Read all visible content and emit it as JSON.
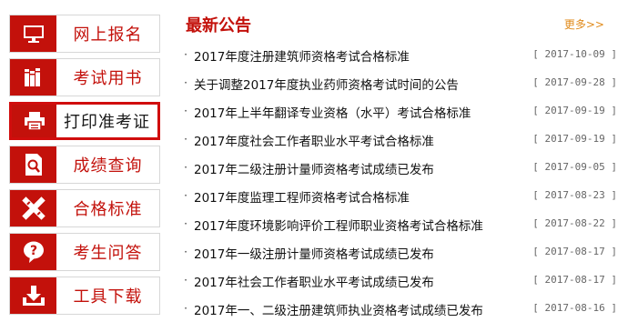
{
  "colors": {
    "brand_red": "#c3110b",
    "active_border": "#d00d0d",
    "more_orange": "#e08a1a"
  },
  "sidebar": {
    "items": [
      {
        "label": "网上报名",
        "icon": "monitor-icon",
        "active": false
      },
      {
        "label": "考试用书",
        "icon": "books-icon",
        "active": false
      },
      {
        "label": "打印准考证",
        "icon": "printer-icon",
        "active": true
      },
      {
        "label": "成绩查询",
        "icon": "document-search-icon",
        "active": false
      },
      {
        "label": "合格标准",
        "icon": "ruler-pencil-icon",
        "active": false
      },
      {
        "label": "考生问答",
        "icon": "question-bubble-icon",
        "active": false
      },
      {
        "label": "工具下载",
        "icon": "download-tray-icon",
        "active": false
      }
    ]
  },
  "news": {
    "title": "最新公告",
    "more_label": "更多>>",
    "items": [
      {
        "text": "2017年度注册建筑师资格考试合格标准",
        "date": "[ 2017-10-09 ]"
      },
      {
        "text": "关于调整2017年度执业药师资格考试时间的公告",
        "date": "[ 2017-09-28 ]"
      },
      {
        "text": "2017年上半年翻译专业资格（水平）考试合格标准",
        "date": "[ 2017-09-19 ]"
      },
      {
        "text": "2017年度社会工作者职业水平考试合格标准",
        "date": "[ 2017-09-19 ]"
      },
      {
        "text": "2017年二级注册计量师资格考试成绩已发布",
        "date": "[ 2017-09-05 ]"
      },
      {
        "text": "2017年度监理工程师资格考试合格标准",
        "date": "[ 2017-08-23 ]"
      },
      {
        "text": "2017年度环境影响评价工程师职业资格考试合格标准",
        "date": "[ 2017-08-22 ]"
      },
      {
        "text": "2017年一级注册计量师资格考试成绩已发布",
        "date": "[ 2017-08-17 ]"
      },
      {
        "text": "2017年社会工作者职业水平考试成绩已发布",
        "date": "[ 2017-08-17 ]"
      },
      {
        "text": "2017年一、二级注册建筑师执业资格考试成绩已发布",
        "date": "[ 2017-08-16 ]"
      }
    ]
  }
}
